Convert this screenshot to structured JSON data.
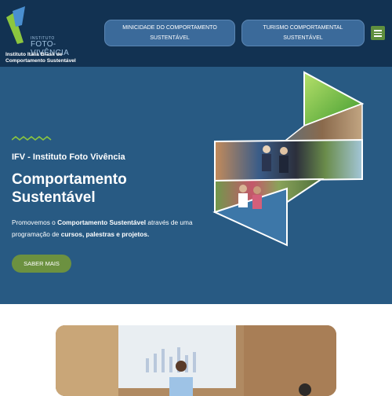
{
  "header": {
    "logo": {
      "small_text": "INSTITUTO",
      "name": "FOTO-VIVÊNCIA",
      "tagline": "Instituto Itália Brasil de Comportamento Sustentável"
    },
    "nav": [
      {
        "label": "MINICIDADE DO COMPORTAMENTO SUSTENTÁVEL"
      },
      {
        "label": "TURISMO COMPORTAMENTAL SUSTENTÁVEL"
      }
    ],
    "menu_icon": "hamburger-icon"
  },
  "hero": {
    "eyebrow": "IFV - Instituto Foto Vivência",
    "title": "Comportamento Sustentável",
    "desc_1": "Promovemos o ",
    "desc_bold_1": "Comportamento Sustentável",
    "desc_2": " através de uma programação de ",
    "desc_bold_2": "cursos, palestras e projetos.",
    "cta_label": "SABER MAIS"
  },
  "colors": {
    "header_bg": "#123252",
    "hero_bg": "#285a83",
    "accent_green": "#6c9140",
    "nav_button": "#3b6a9a"
  }
}
